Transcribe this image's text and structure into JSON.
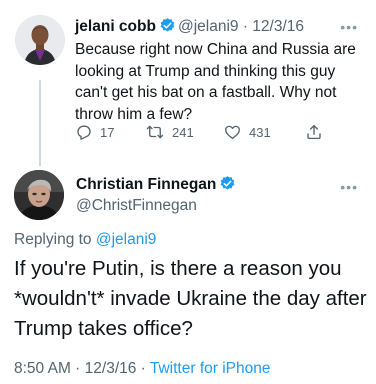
{
  "parent_tweet": {
    "name": "jelani cobb",
    "handle": "@jelani9",
    "date": "12/3/16",
    "text": "Because right now China and Russia are looking at Trump and thinking this guy can't get his bat on a fastball. Why not throw him a few?",
    "replies": "17",
    "retweets": "241",
    "likes": "431"
  },
  "main_tweet": {
    "name": "Christian Finnegan",
    "handle": "@ChristFinnegan",
    "replying_prefix": "Replying to",
    "replying_to": "@jelani9",
    "text": "If you're Putin, is there a reason you *wouldn't* invade Ukraine the day after Trump takes office?",
    "time": "8:50 AM",
    "date": "12/3/16",
    "source": "Twitter for iPhone"
  },
  "colors": {
    "accent": "#1d9bf0",
    "secondary_text": "#536471",
    "primary_text": "#0f1419"
  }
}
